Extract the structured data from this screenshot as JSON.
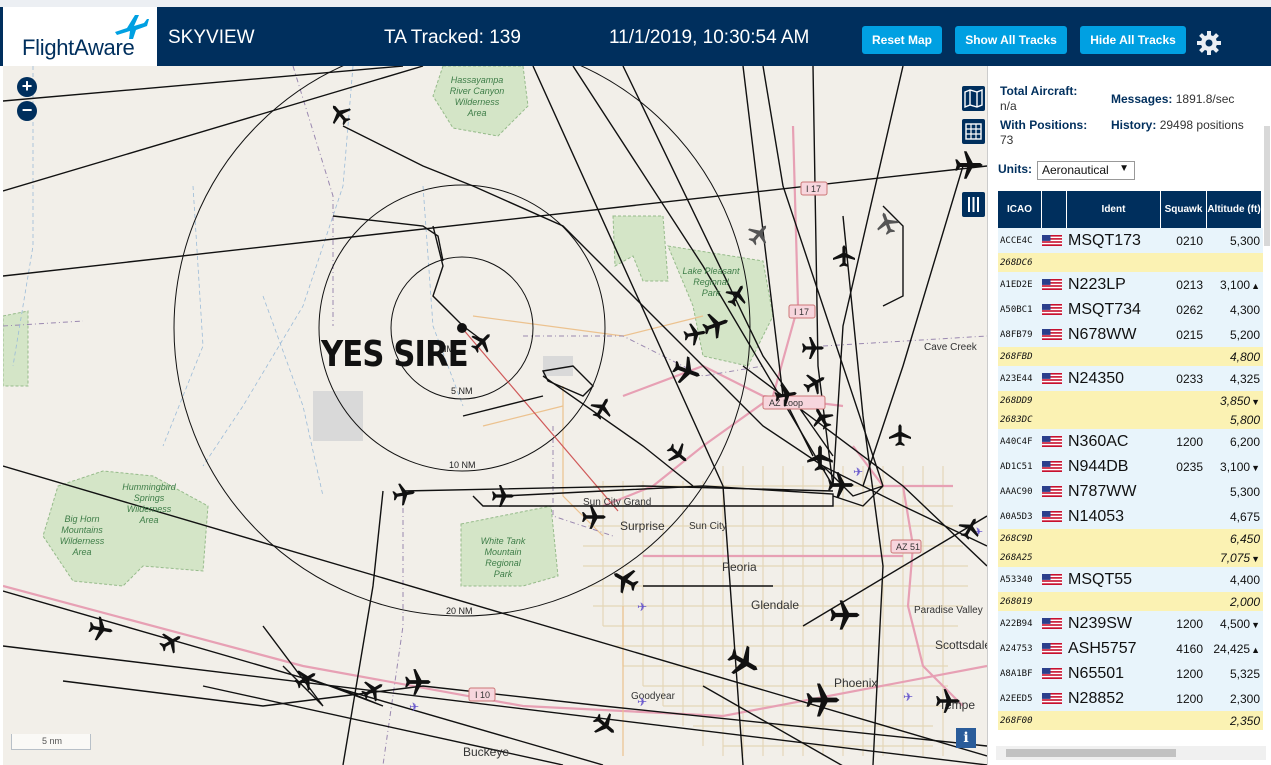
{
  "header": {
    "logo_text": "FlightAware",
    "site_name": "SKYVIEW",
    "tracked": "TA Tracked: 139",
    "clock": "11/1/2019, 10:30:54 AM",
    "buttons": {
      "reset": "Reset Map",
      "show_all": "Show All Tracks",
      "hide_all": "Hide All Tracks"
    }
  },
  "map": {
    "annotation": "YES SIRE",
    "zoom_in": "+",
    "zoom_out": "−",
    "info": "i",
    "scale": "5 nm",
    "rings": [
      "5 NM",
      "10 NM",
      "20 NM"
    ],
    "site_label": "NM",
    "places": {
      "hassayampa_1": "Hassayampa",
      "hassayampa_2": "River Canyon",
      "hassayampa_3": "Wilderness",
      "hassayampa_4": "Area",
      "lake_1": "Lake Pleasant",
      "lake_2": "Regional",
      "lake_3": "Park",
      "humming_1": "Hummingbird",
      "humming_2": "Springs",
      "humming_3": "Wilderness",
      "humming_4": "Area",
      "bighorn_1": "Big Horn",
      "bighorn_2": "Mountains",
      "bighorn_3": "Wilderness",
      "bighorn_4": "Area",
      "whitetank_1": "White Tank",
      "whitetank_2": "Mountain",
      "whitetank_3": "Regional",
      "whitetank_4": "Park"
    },
    "cities": {
      "cave_creek": "Cave Creek",
      "sun_city_grand": "Sun City Grand",
      "surprise": "Surprise",
      "sun_city": "Sun City",
      "peoria": "Peoria",
      "glendale": "Glendale",
      "paradise_valley": "Paradise Valley",
      "scottsdale": "Scottsdale",
      "phoenix": "Phoenix",
      "tempe": "Tempe",
      "goodyear": "Goodyear",
      "buckeye": "Buckeye"
    },
    "shields": {
      "i17a": "I 17",
      "i17b": "I 17",
      "loop": "AZ Loop",
      "az51": "AZ 51",
      "i10": "I 10"
    }
  },
  "panel": {
    "total_label": "Total Aircraft:",
    "total_value": "n/a",
    "messages_label": "Messages:",
    "messages_value": "1891.8/sec",
    "positions_label": "With Positions:",
    "positions_value": "73",
    "history_label": "History:",
    "history_value": "29498 positions",
    "units_label": "Units:",
    "units_value": "Aeronautical",
    "columns": {
      "icao": "ICAO",
      "ident": "Ident",
      "squawk": "Squawk",
      "altitude": "Altitude (ft)"
    },
    "rows": [
      {
        "icao": "ACCE4C",
        "flag": true,
        "ident": "MSQT173",
        "squawk": "0210",
        "alt": "5,300",
        "trend": "",
        "style": "blue"
      },
      {
        "icao": "268DC6",
        "flag": false,
        "ident": "",
        "squawk": "",
        "alt": "",
        "trend": "",
        "style": "yellow"
      },
      {
        "icao": "A1ED2E",
        "flag": true,
        "ident": "N223LP",
        "squawk": "0213",
        "alt": "3,100",
        "trend": "▲",
        "style": "blue"
      },
      {
        "icao": "A50BC1",
        "flag": true,
        "ident": "MSQT734",
        "squawk": "0262",
        "alt": "4,300",
        "trend": "",
        "style": "blue"
      },
      {
        "icao": "A8FB79",
        "flag": true,
        "ident": "N678WW",
        "squawk": "0215",
        "alt": "5,200",
        "trend": "",
        "style": "blue"
      },
      {
        "icao": "268FBD",
        "flag": false,
        "ident": "",
        "squawk": "",
        "alt": "4,800",
        "trend": "",
        "style": "yellow"
      },
      {
        "icao": "A23E44",
        "flag": true,
        "ident": "N24350",
        "squawk": "0233",
        "alt": "4,325",
        "trend": "",
        "style": "blue"
      },
      {
        "icao": "268DD9",
        "flag": false,
        "ident": "",
        "squawk": "",
        "alt": "3,850",
        "trend": "▼",
        "style": "yellow"
      },
      {
        "icao": "2683DC",
        "flag": false,
        "ident": "",
        "squawk": "",
        "alt": "5,800",
        "trend": "",
        "style": "yellow"
      },
      {
        "icao": "A40C4F",
        "flag": true,
        "ident": "N360AC",
        "squawk": "1200",
        "alt": "6,200",
        "trend": "",
        "style": "blue"
      },
      {
        "icao": "AD1C51",
        "flag": true,
        "ident": "N944DB",
        "squawk": "0235",
        "alt": "3,100",
        "trend": "▼",
        "style": "blue"
      },
      {
        "icao": "AAAC90",
        "flag": true,
        "ident": "N787WW",
        "squawk": "",
        "alt": "5,300",
        "trend": "",
        "style": "blue"
      },
      {
        "icao": "A0A5D3",
        "flag": true,
        "ident": "N14053",
        "squawk": "",
        "alt": "4,675",
        "trend": "",
        "style": "blue"
      },
      {
        "icao": "268C9D",
        "flag": false,
        "ident": "",
        "squawk": "",
        "alt": "6,450",
        "trend": "",
        "style": "yellow"
      },
      {
        "icao": "268A25",
        "flag": false,
        "ident": "",
        "squawk": "",
        "alt": "7,075",
        "trend": "▼",
        "style": "yellow"
      },
      {
        "icao": "A53340",
        "flag": true,
        "ident": "MSQT55",
        "squawk": "",
        "alt": "4,400",
        "trend": "",
        "style": "blue"
      },
      {
        "icao": "268019",
        "flag": false,
        "ident": "",
        "squawk": "",
        "alt": "2,000",
        "trend": "",
        "style": "yellow"
      },
      {
        "icao": "A22B94",
        "flag": true,
        "ident": "N239SW",
        "squawk": "1200",
        "alt": "4,500",
        "trend": "▼",
        "style": "blue"
      },
      {
        "icao": "A24753",
        "flag": true,
        "ident": "ASH5757",
        "squawk": "4160",
        "alt": "24,425",
        "trend": "▲",
        "style": "blue"
      },
      {
        "icao": "A8A1BF",
        "flag": true,
        "ident": "N65501",
        "squawk": "1200",
        "alt": "5,325",
        "trend": "",
        "style": "blue"
      },
      {
        "icao": "A2EED5",
        "flag": true,
        "ident": "N28852",
        "squawk": "1200",
        "alt": "2,300",
        "trend": "",
        "style": "blue"
      },
      {
        "icao": "268F00",
        "flag": false,
        "ident": "",
        "squawk": "",
        "alt": "2,350",
        "trend": "",
        "style": "yellow"
      }
    ]
  }
}
